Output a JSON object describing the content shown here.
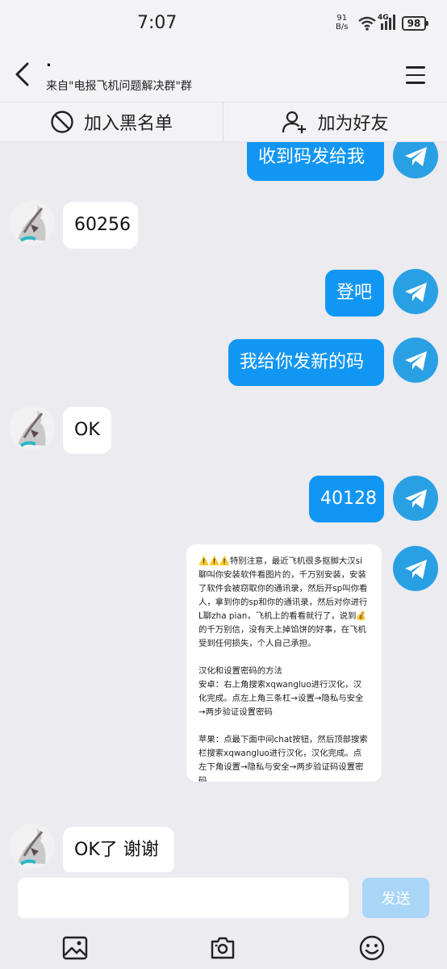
{
  "status_bar": {
    "time": "7:07",
    "net_rate_value": "91",
    "net_rate_unit": "B/s",
    "signal_label": "4G",
    "battery": "98"
  },
  "header": {
    "title": ".",
    "subtitle": "来自\"电报飞机问题解决群\"群"
  },
  "actions": {
    "block": "加入黑名单",
    "add_friend": "加为好友"
  },
  "messages": [
    {
      "side": "out",
      "text": "收到码发给我"
    },
    {
      "side": "in",
      "text": "60256"
    },
    {
      "side": "out",
      "text": "登吧"
    },
    {
      "side": "out",
      "text": "我给你发新的码"
    },
    {
      "side": "in",
      "text": "OK"
    },
    {
      "side": "out",
      "text": "40128"
    },
    {
      "side": "in",
      "text": "OK了 谢谢"
    }
  ],
  "notice": {
    "p1": "⚠️⚠️⚠️特别注意，最近飞机很多抠脚大汉si聊叫你安装软件看图片的，千万别安装，安装了软件会被窃取你的通讯录，然后开sp叫你看人，拿到你的sp和你的通讯录，然后对你进行L聊zha pian，飞机上的看看就行了，说到💰的千万别信，没有天上掉馅饼的好事，在飞机受到任何损失，个人自己承担。",
    "p2_title": "汉化和设置密码的方法",
    "p2": "安卓：右上角搜索xqwangluo进行汉化，汉化完成。点左上角三条杠→设置→隐私与安全→两步验证设置密码",
    "p3": "苹果：点最下面中间chat按钮，然后顶部搜索栏搜索xqwangluo进行汉化，汉化完成。点左下角设置→隐私与安全→两步验证码设置密码"
  },
  "composer": {
    "placeholder": "",
    "send_label": "发送"
  },
  "colors": {
    "accent": "#1296f3",
    "telegram": "#2aa0e4",
    "send_disabled": "#a9d6f7",
    "background": "#ebebf0"
  },
  "icons": {
    "back": "chevron-left-icon",
    "menu": "hamburger-icon",
    "block": "block-icon",
    "add_friend": "add-user-icon",
    "telegram": "telegram-icon",
    "image": "image-icon",
    "camera": "camera-icon",
    "emoji": "emoji-icon"
  }
}
